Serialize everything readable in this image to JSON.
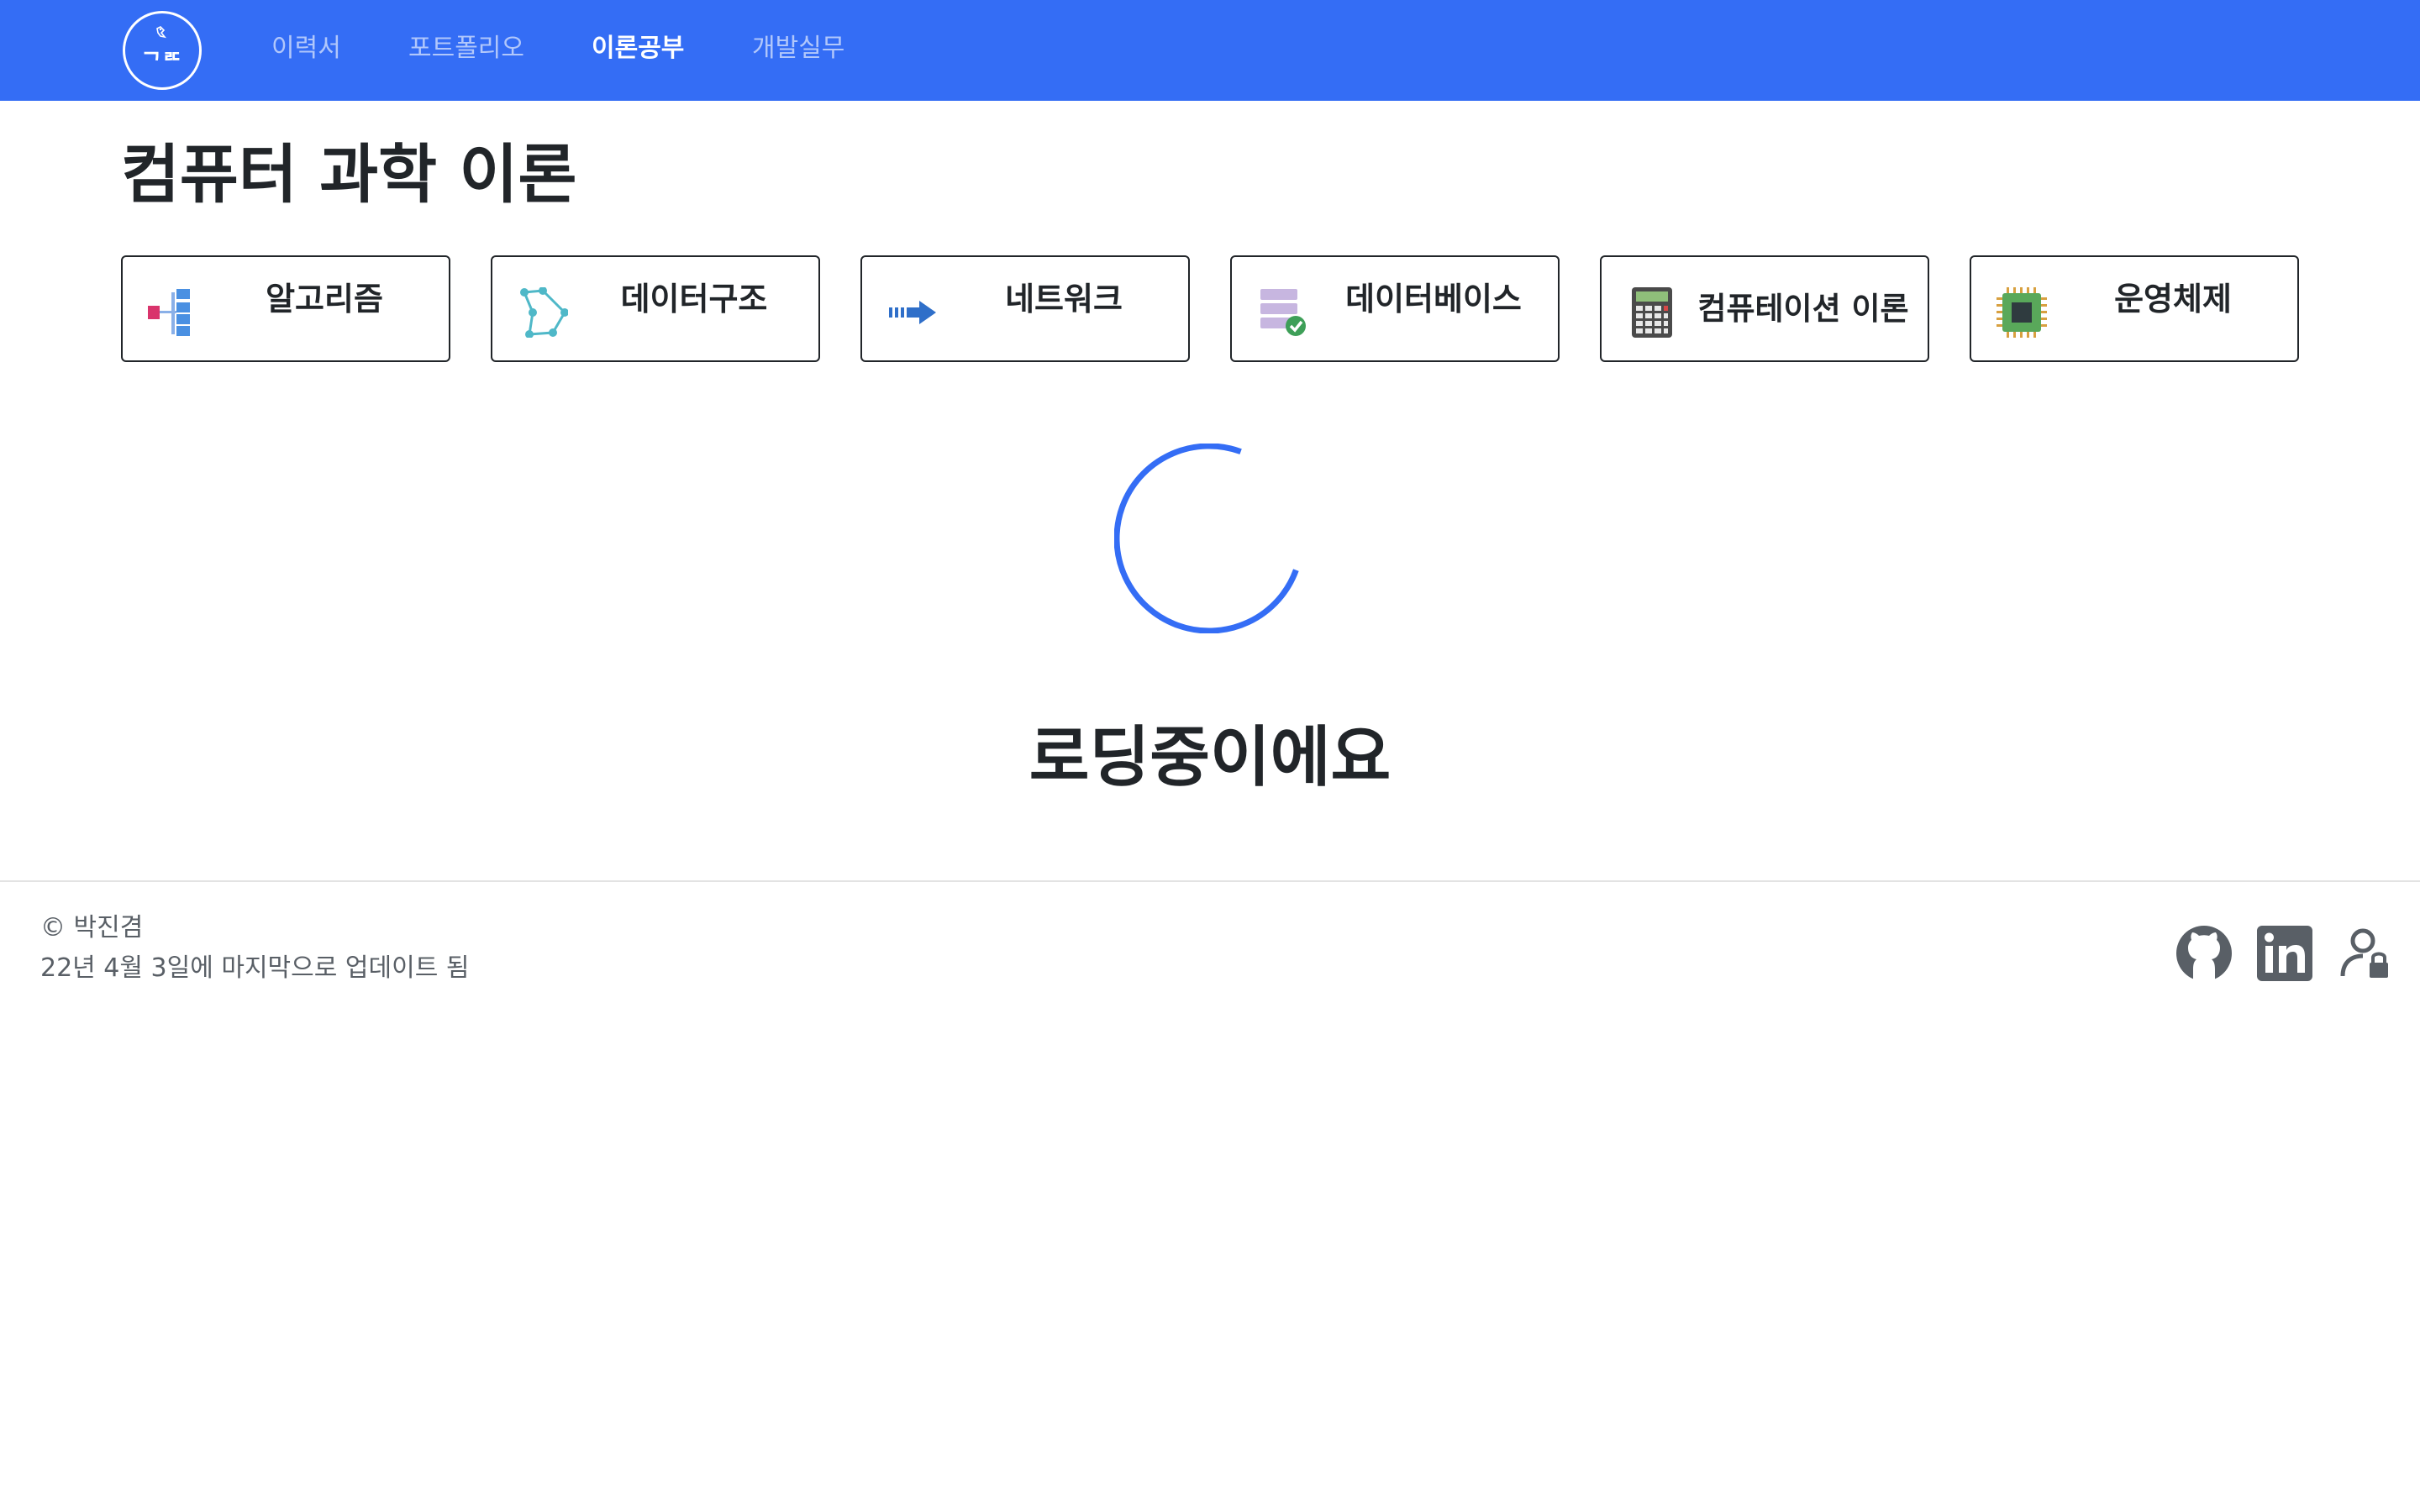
{
  "nav": {
    "logo_text": "ᄀᄅᄃ",
    "links": [
      {
        "label": "이력서",
        "active": false
      },
      {
        "label": "포트폴리오",
        "active": false
      },
      {
        "label": "이론공부",
        "active": true
      },
      {
        "label": "개발실무",
        "active": false
      }
    ],
    "color": "#346df5"
  },
  "page": {
    "title": "컴퓨터 과학 이론"
  },
  "categories": [
    {
      "label": "알고리즘",
      "icon": "hierarchy-icon"
    },
    {
      "label": "데이터구조",
      "icon": "graph-nodes-icon"
    },
    {
      "label": "네트워크",
      "icon": "arrow-right-icon"
    },
    {
      "label": "데이터베이스",
      "icon": "database-check-icon"
    },
    {
      "label": "컴퓨테이션 이론",
      "icon": "calculator-icon"
    },
    {
      "label": "운영체제",
      "icon": "cpu-chip-icon"
    }
  ],
  "loading": {
    "text": "로딩중이에요",
    "spinner_color": "#346df5"
  },
  "footer": {
    "copyright": "© 박진겸",
    "updated": "22년 4월 3일에 마지막으로 업데이트 됨",
    "links": [
      "github-icon",
      "linkedin-icon",
      "user-lock-icon"
    ]
  }
}
